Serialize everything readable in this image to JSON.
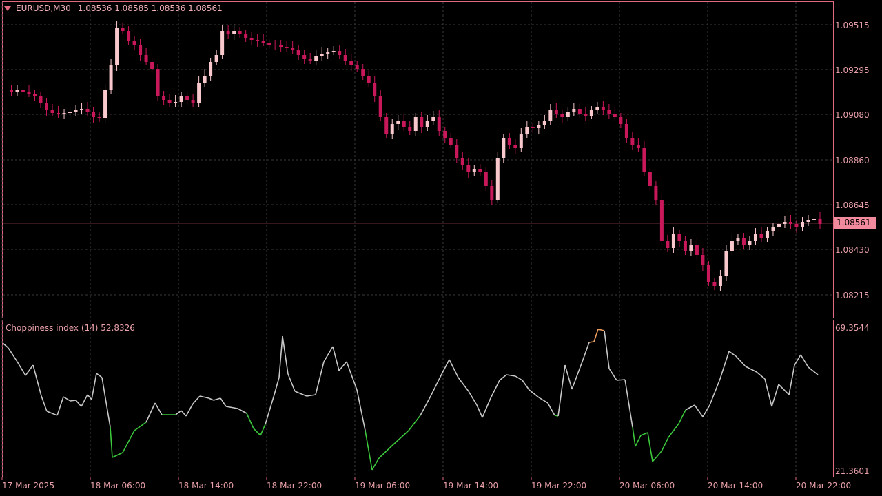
{
  "header": {
    "symbol": "EURUSD,M30",
    "ohlc": "1.08536 1.08585 1.08536 1.08561",
    "menu_icon": "triangle-down-icon"
  },
  "price_axis": {
    "labels": [
      "1.09515",
      "1.09295",
      "1.09080",
      "1.08860",
      "1.08645",
      "1.08430",
      "1.08215"
    ],
    "current": "1.08561"
  },
  "indicator": {
    "label": "Choppiness index (14) 52.8326",
    "max_label": "69.3544",
    "min_label": "21.3601"
  },
  "time_axis": {
    "labels": [
      "17 Mar 2025",
      "18 Mar 06:00",
      "18 Mar 14:00",
      "18 Mar 22:00",
      "19 Mar 06:00",
      "19 Mar 14:00",
      "19 Mar 22:00",
      "20 Mar 06:00",
      "20 Mar 14:00",
      "20 Mar 22:00"
    ]
  },
  "colors": {
    "bull": "#f8c8cc",
    "bear": "#c8185a",
    "grid": "#3a3a3a",
    "frame": "#e06a80",
    "ind_normal": "#c8c8c8",
    "ind_trend": "#3cc83c",
    "ind_range": "#f0a060"
  }
}
